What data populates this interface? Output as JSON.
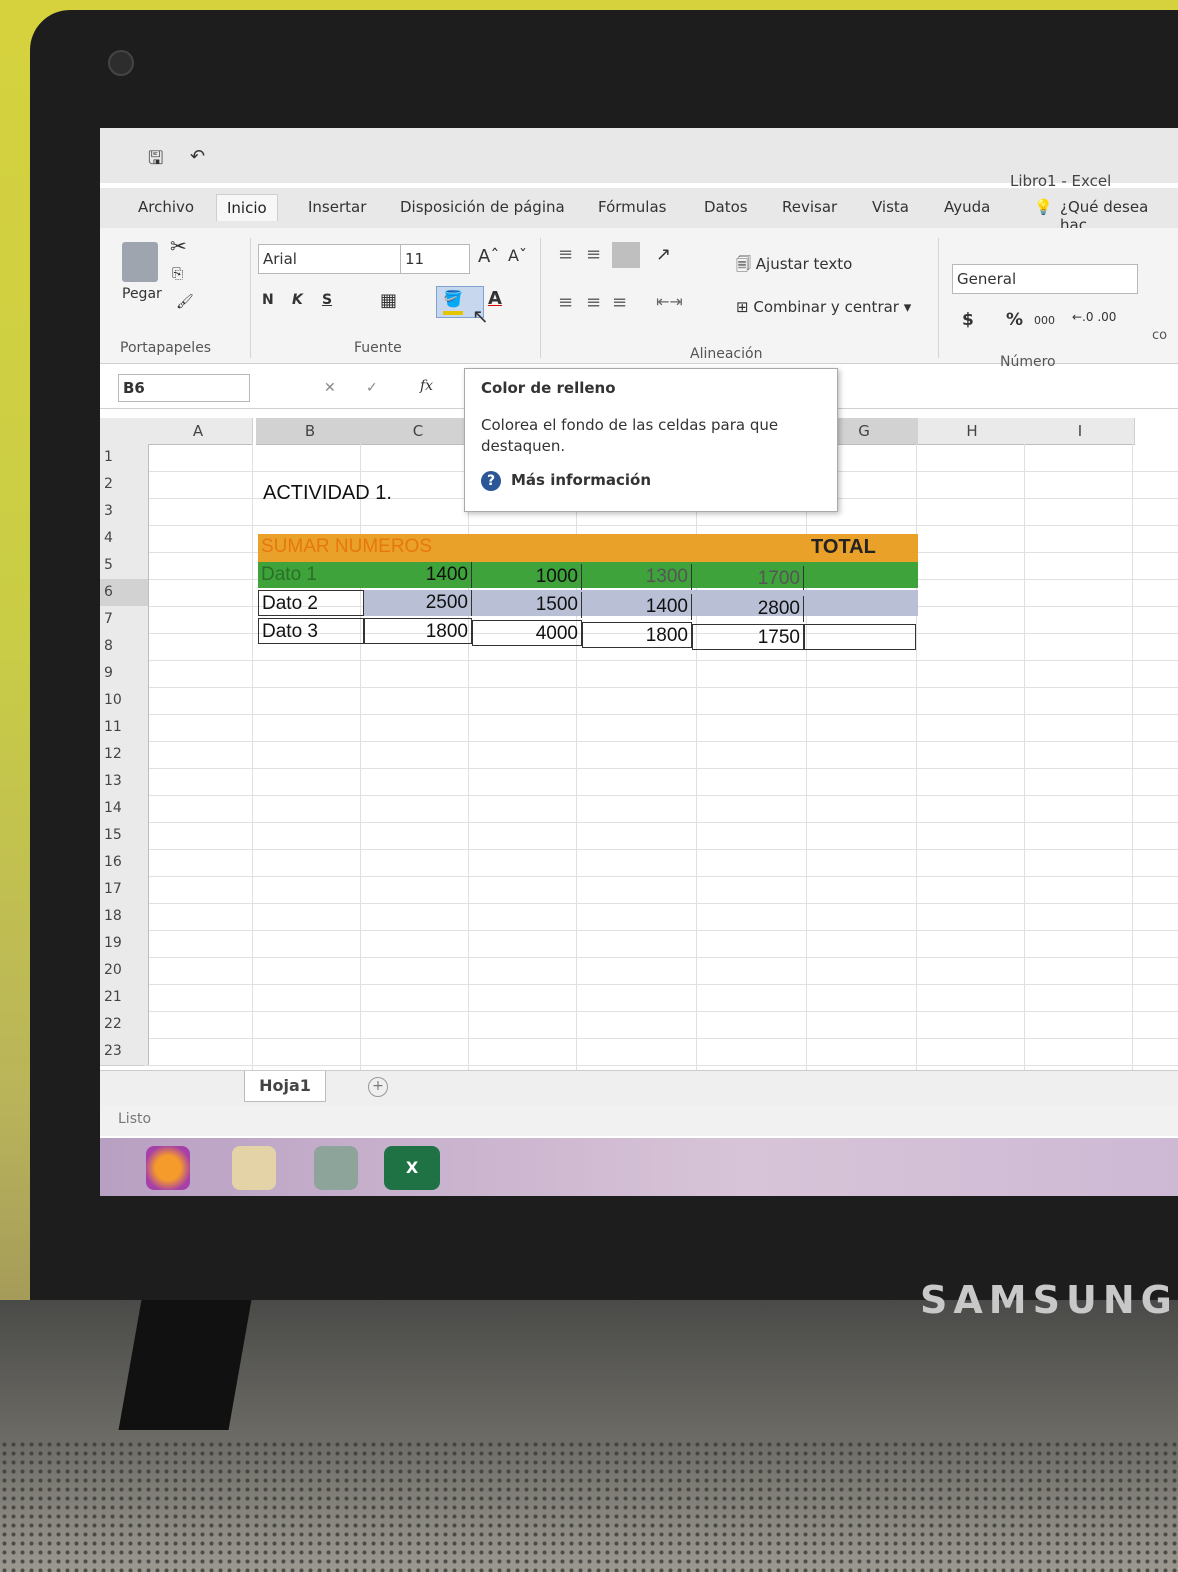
{
  "window": {
    "title": "Libro1 - Excel"
  },
  "tabs": [
    "Archivo",
    "Inicio",
    "Insertar",
    "Disposición de página",
    "Fórmulas",
    "Datos",
    "Revisar",
    "Vista",
    "Ayuda"
  ],
  "tell_me": "¿Qué desea hac",
  "ribbon": {
    "paste_label": "Pegar",
    "font_name": "Arial",
    "font_size": "11",
    "bold": "N",
    "italic": "K",
    "underline": "S",
    "wrap_text": "Ajustar texto",
    "merge_center": "Combinar y centrar",
    "number_format": "General",
    "currency": "$",
    "percent": "%",
    "thousands": "000",
    "groups": [
      "Portapapeles",
      "Fuente",
      "Alineación",
      "Número"
    ],
    "cut_partial": "co"
  },
  "formula_bar": {
    "name_box": "B6",
    "fx": "fx"
  },
  "tooltip": {
    "title": "Color de relleno",
    "description": "Colorea el fondo de las celdas para que destaquen.",
    "help_link": "Más información"
  },
  "columns": [
    "A",
    "B",
    "C",
    "G",
    "H",
    "I"
  ],
  "rows": [
    "1",
    "2",
    "3",
    "4",
    "5",
    "6",
    "7",
    "8",
    "9",
    "10",
    "11",
    "12",
    "13",
    "14",
    "15",
    "16",
    "17",
    "18",
    "19",
    "20",
    "21",
    "22",
    "23"
  ],
  "sheet": {
    "title": "ACTIVIDAD 1.",
    "header": "SUMAR NUMEROS",
    "total_label": "TOTAL",
    "data": [
      {
        "label": "Dato 1",
        "values": [
          "1400",
          "1000",
          "1300",
          "1700"
        ]
      },
      {
        "label": "Dato 2",
        "values": [
          "2500",
          "1500",
          "1400",
          "2800"
        ]
      },
      {
        "label": "Dato 3",
        "values": [
          "1800",
          "4000",
          "1800",
          "1750"
        ]
      }
    ]
  },
  "sheet_tab": "Hoja1",
  "status": "Listo",
  "brand": "SAMSUNG",
  "colors": {
    "orange": "#e9a12a",
    "green": "#3ea33a",
    "selected": "#b9c0d6"
  }
}
